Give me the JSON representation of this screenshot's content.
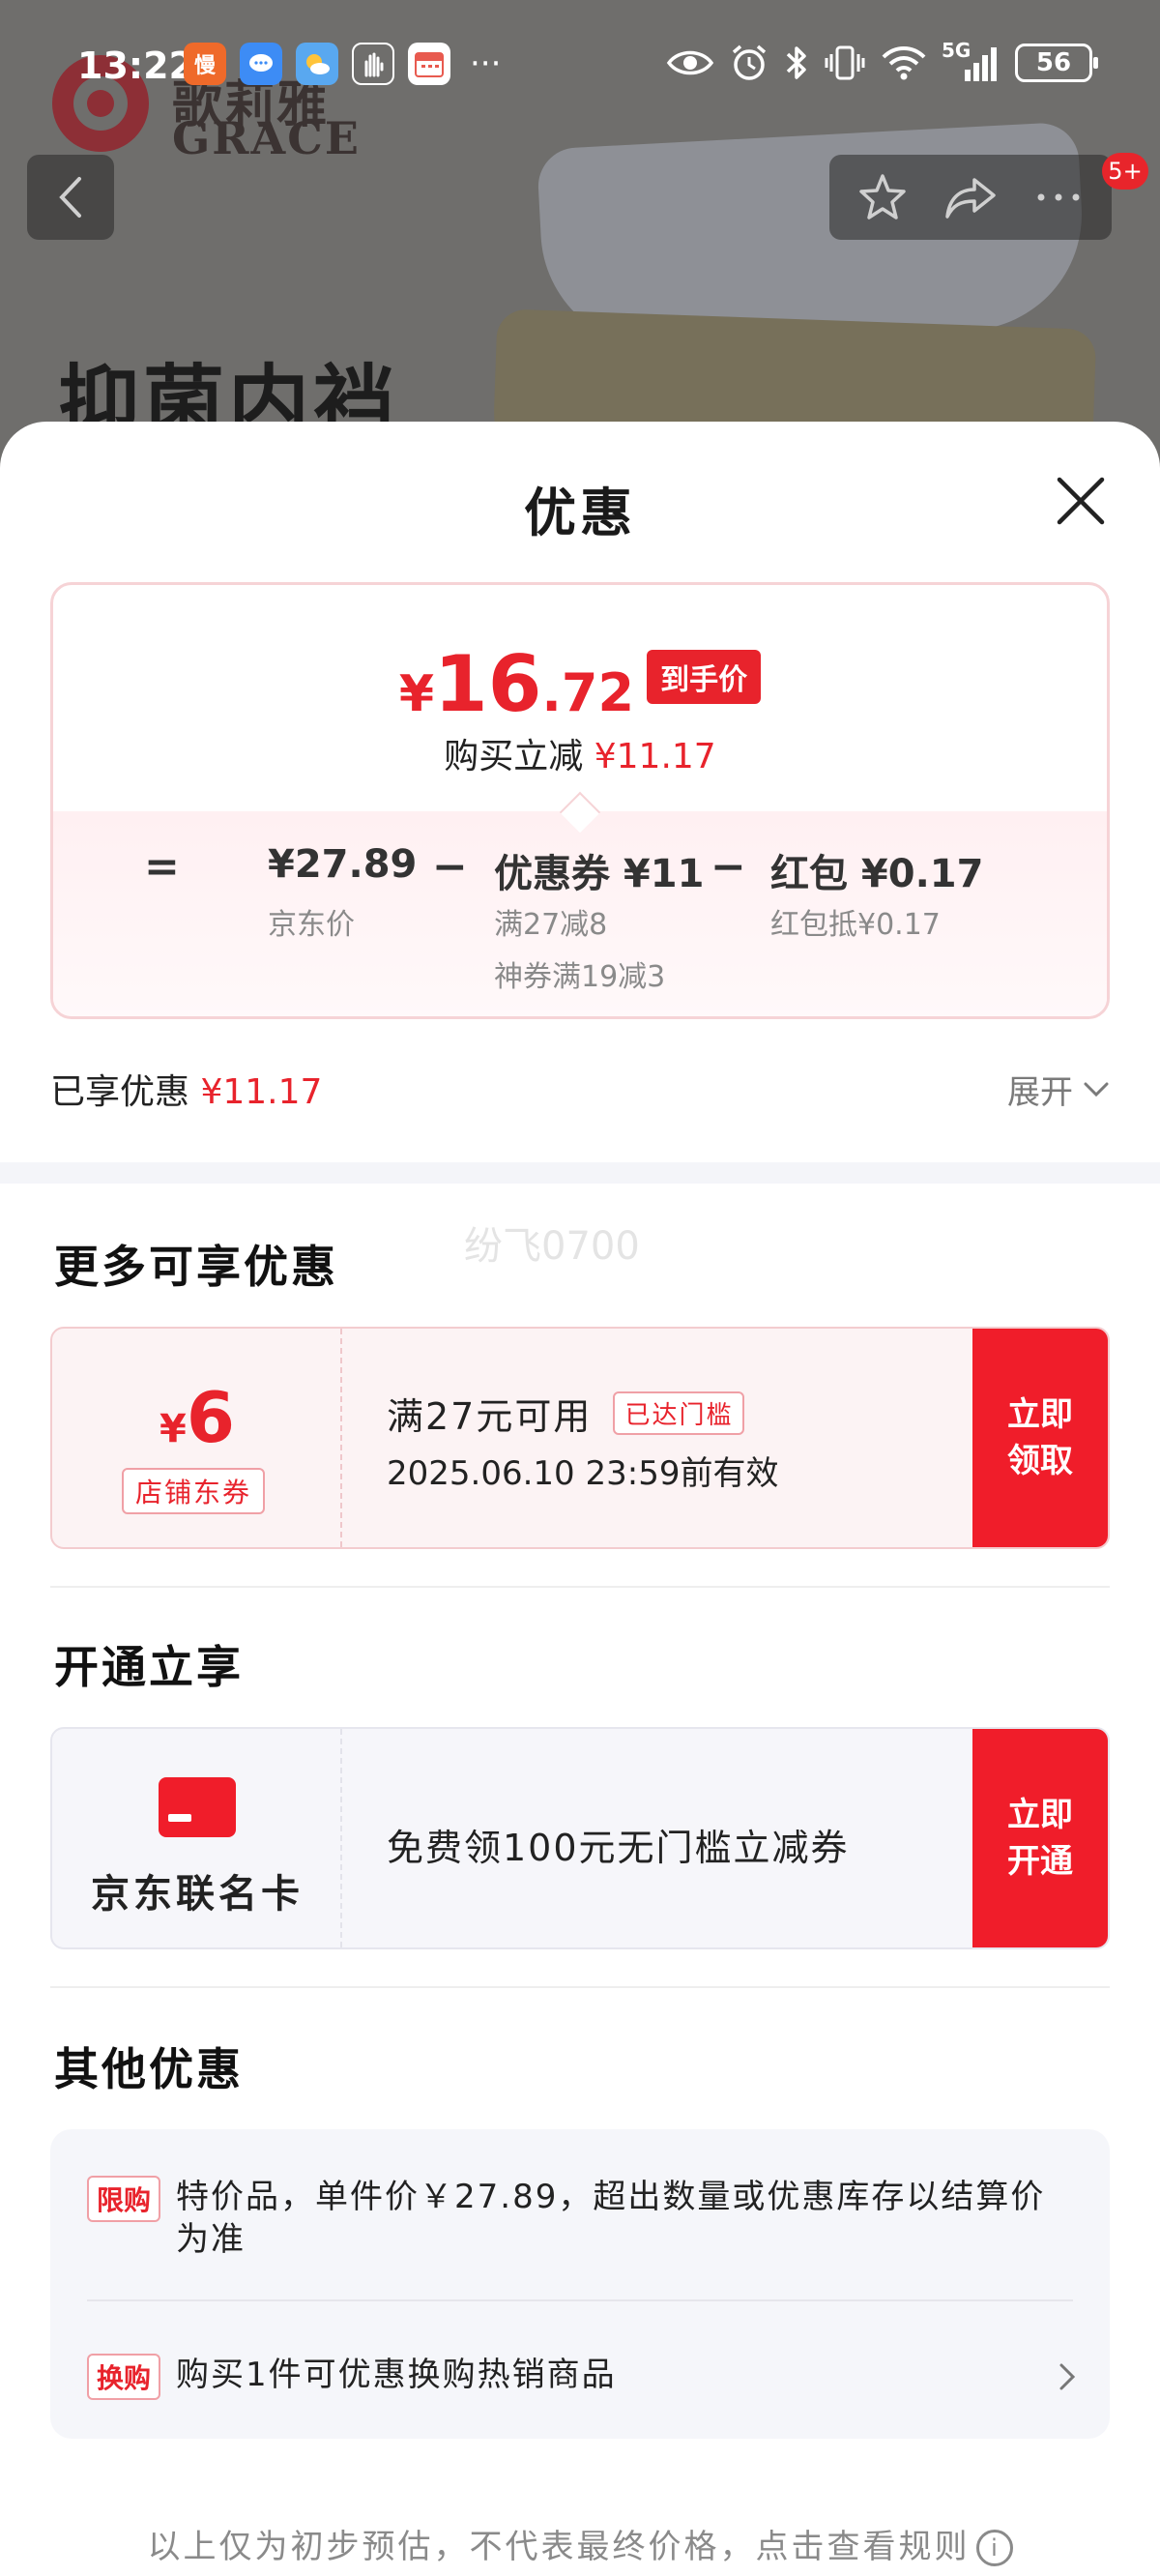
{
  "status_bar": {
    "time": "13:22",
    "network": "5G",
    "battery": "56",
    "notification_more": "···",
    "app_icons": [
      "manman-app-icon",
      "message-app-icon",
      "weather-app-icon",
      "gesture-app-icon",
      "calendar-app-icon"
    ]
  },
  "background": {
    "brand_cn": "歌莉雅",
    "brand_en": "GRACE",
    "product_title": "抑菌内裆",
    "cart_badge": "5+"
  },
  "sheet": {
    "title": "优惠",
    "price_card": {
      "currency": "¥",
      "final_int": "16",
      "final_dec": ".72",
      "final_tag": "到手价",
      "reduce_label": "购买立减",
      "reduce_amount": "¥11.17",
      "equals": "=",
      "minus": "−",
      "jd_price": "¥27.89",
      "jd_price_label": "京东价",
      "coupon_label": "优惠券 ¥11",
      "coupon_sub1": "满27减8",
      "coupon_sub2": "神券满19减3",
      "redpack_label": "红包 ¥0.17",
      "redpack_sub": "红包抵¥0.17"
    },
    "enjoyed_label": "已享优惠",
    "enjoyed_amount": "¥11.17",
    "expand_label": "展开",
    "watermark": "纷飞0700",
    "more_offers": {
      "title": "更多可享优惠",
      "coupon": {
        "currency": "¥",
        "value": "6",
        "type_tag": "店铺东券",
        "condition": "满27元可用",
        "reached_tag": "已达门槛",
        "expiry": "2025.06.10 23:59前有效",
        "button": "立即领取"
      }
    },
    "open_enjoy": {
      "title": "开通立享",
      "card_name": "京东联名卡",
      "offer": "免费领100元无门槛立减券",
      "button": "立即开通"
    },
    "other_offers": {
      "title": "其他优惠",
      "items": [
        {
          "tag": "限购",
          "text": "特价品，单件价￥27.89，超出数量或优惠库存以结算价为准"
        },
        {
          "tag": "换购",
          "text": "购买1件可优惠换购热销商品"
        }
      ]
    },
    "footer_note": "以上仅为初步预估，不代表最终价格，点击查看规则",
    "footer_info_icon": "i"
  },
  "colors": {
    "accent_red": "#e8232c",
    "button_red": "#f01d2a",
    "overlay_gray": "#6f6e6c"
  }
}
